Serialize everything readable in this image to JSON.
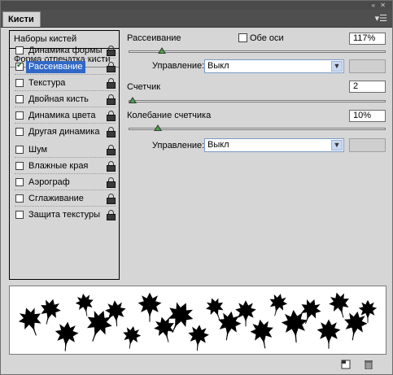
{
  "window": {
    "buttons": "« ✕"
  },
  "tab": {
    "title": "Кисти",
    "menu_icon": "▾☰"
  },
  "left_panel": {
    "header": "Наборы кистей",
    "section_title": "Форма отпечатка кисти",
    "items": [
      {
        "label": "Динамика формы",
        "checked": false,
        "selected": false
      },
      {
        "label": "Рассеивание",
        "checked": true,
        "selected": true
      },
      {
        "label": "Текстура",
        "checked": false,
        "selected": false
      },
      {
        "label": "Двойная кисть",
        "checked": false,
        "selected": false
      },
      {
        "label": "Динамика цвета",
        "checked": false,
        "selected": false
      },
      {
        "label": "Другая динамика",
        "checked": false,
        "selected": false
      },
      {
        "label": "Шум",
        "checked": false,
        "selected": false
      },
      {
        "label": "Влажные края",
        "checked": false,
        "selected": false
      },
      {
        "label": "Аэрограф",
        "checked": false,
        "selected": false
      },
      {
        "label": "Сглаживание",
        "checked": false,
        "selected": false
      },
      {
        "label": "Защита текстуры",
        "checked": false,
        "selected": false
      }
    ]
  },
  "scatter": {
    "label": "Рассеивание",
    "both_axes_label": "Обе оси",
    "both_axes_checked": false,
    "value": "117%",
    "slider_fraction": 0.117,
    "control_label": "Управление:",
    "control_value": "Выкл"
  },
  "count": {
    "label": "Счетчик",
    "value": "2",
    "slider_fraction": 0.0
  },
  "count_jitter": {
    "label": "Колебание счетчика",
    "value": "10%",
    "slider_fraction": 0.1,
    "control_label": "Управление:",
    "control_value": "Выкл"
  },
  "colors": {
    "selection": "#3168c7",
    "panel_bg": "#d6d6d6",
    "tab_bar": "#4f4f4f"
  },
  "footer": {
    "icons": [
      "new-preset-icon",
      "trash-icon"
    ]
  }
}
